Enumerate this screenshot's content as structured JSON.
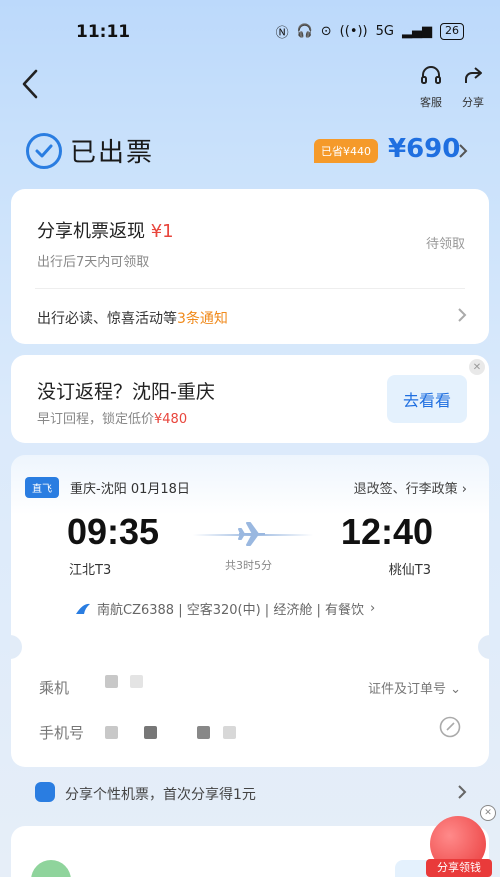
{
  "status_bar": {
    "time": "11:11",
    "network": "5G",
    "battery": "26"
  },
  "nav": {
    "service_label": "客服",
    "share_label": "分享"
  },
  "ticket": {
    "status": "已出票",
    "savings": "已省¥440",
    "price": "¥690"
  },
  "cashback": {
    "title_prefix": "分享机票返现",
    "amount": "¥1",
    "subtitle": "出行后7天内可领取",
    "claim_status": "待领取",
    "notice_prefix": "出行必读、惊喜活动等",
    "notice_count": "3条通知"
  },
  "return_promo": {
    "title": "没订返程？沈阳-重庆",
    "subtitle_prefix": "早订回程，锁定低价",
    "low_price": "¥480",
    "button": "去看看"
  },
  "flight": {
    "tag": "直飞",
    "route_date": "重庆-沈阳 01月18日",
    "policy_link": "退改签、行李政策",
    "dep_time": "09:35",
    "arr_time": "12:40",
    "dep_airport": "江北T3",
    "arr_airport": "桃仙T3",
    "duration": "共3时5分",
    "details": "南航CZ6388 | 空客320(中) | 经济舱 | 有餐饮"
  },
  "passenger": {
    "label": "乘机",
    "doc_link": "证件及订单号",
    "phone_label": "手机号"
  },
  "share_bar": {
    "text": "分享个性机票，首次分享得1元"
  },
  "floating": {
    "label": "分享领钱"
  },
  "colors": {
    "accent": "#2a7de1",
    "price": "#1f6fe0",
    "orange": "#f08a1c",
    "red": "#e8453c"
  }
}
